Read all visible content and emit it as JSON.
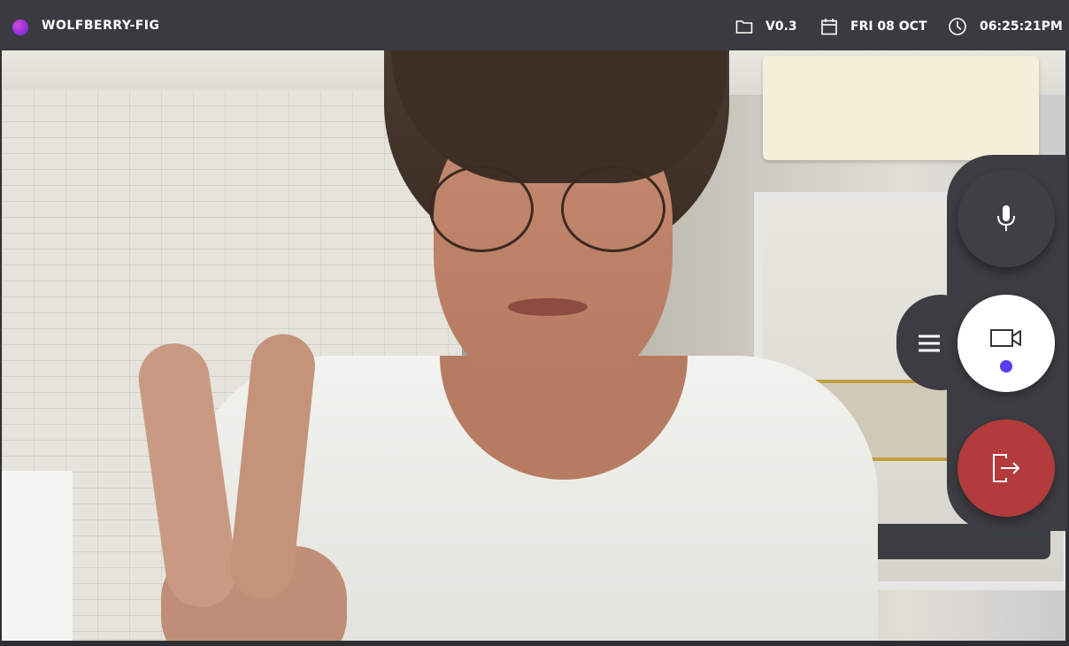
{
  "app": {
    "brand": "WOLFBERRY-FIG",
    "brand_dot_color": "#b33ad8"
  },
  "topbar": {
    "version": {
      "icon": "folder-icon",
      "text": "V0.3"
    },
    "date": {
      "icon": "calendar-icon",
      "text": "FRI 08 OCT"
    },
    "time": {
      "icon": "clock-icon",
      "text": "06:25:21PM"
    }
  },
  "video": {
    "feed": "camera-feed"
  },
  "controls": {
    "menu": {
      "icon": "menu-icon"
    },
    "mic": {
      "icon": "microphone-icon"
    },
    "camera": {
      "icon": "video-camera-icon",
      "active": true,
      "indicator_color": "#5b3cf5"
    },
    "leave": {
      "icon": "exit-icon",
      "color": "#b33b3b"
    }
  },
  "colors": {
    "topbar_bg": "#3a3a40",
    "dock_bg": "#3c3c42"
  }
}
